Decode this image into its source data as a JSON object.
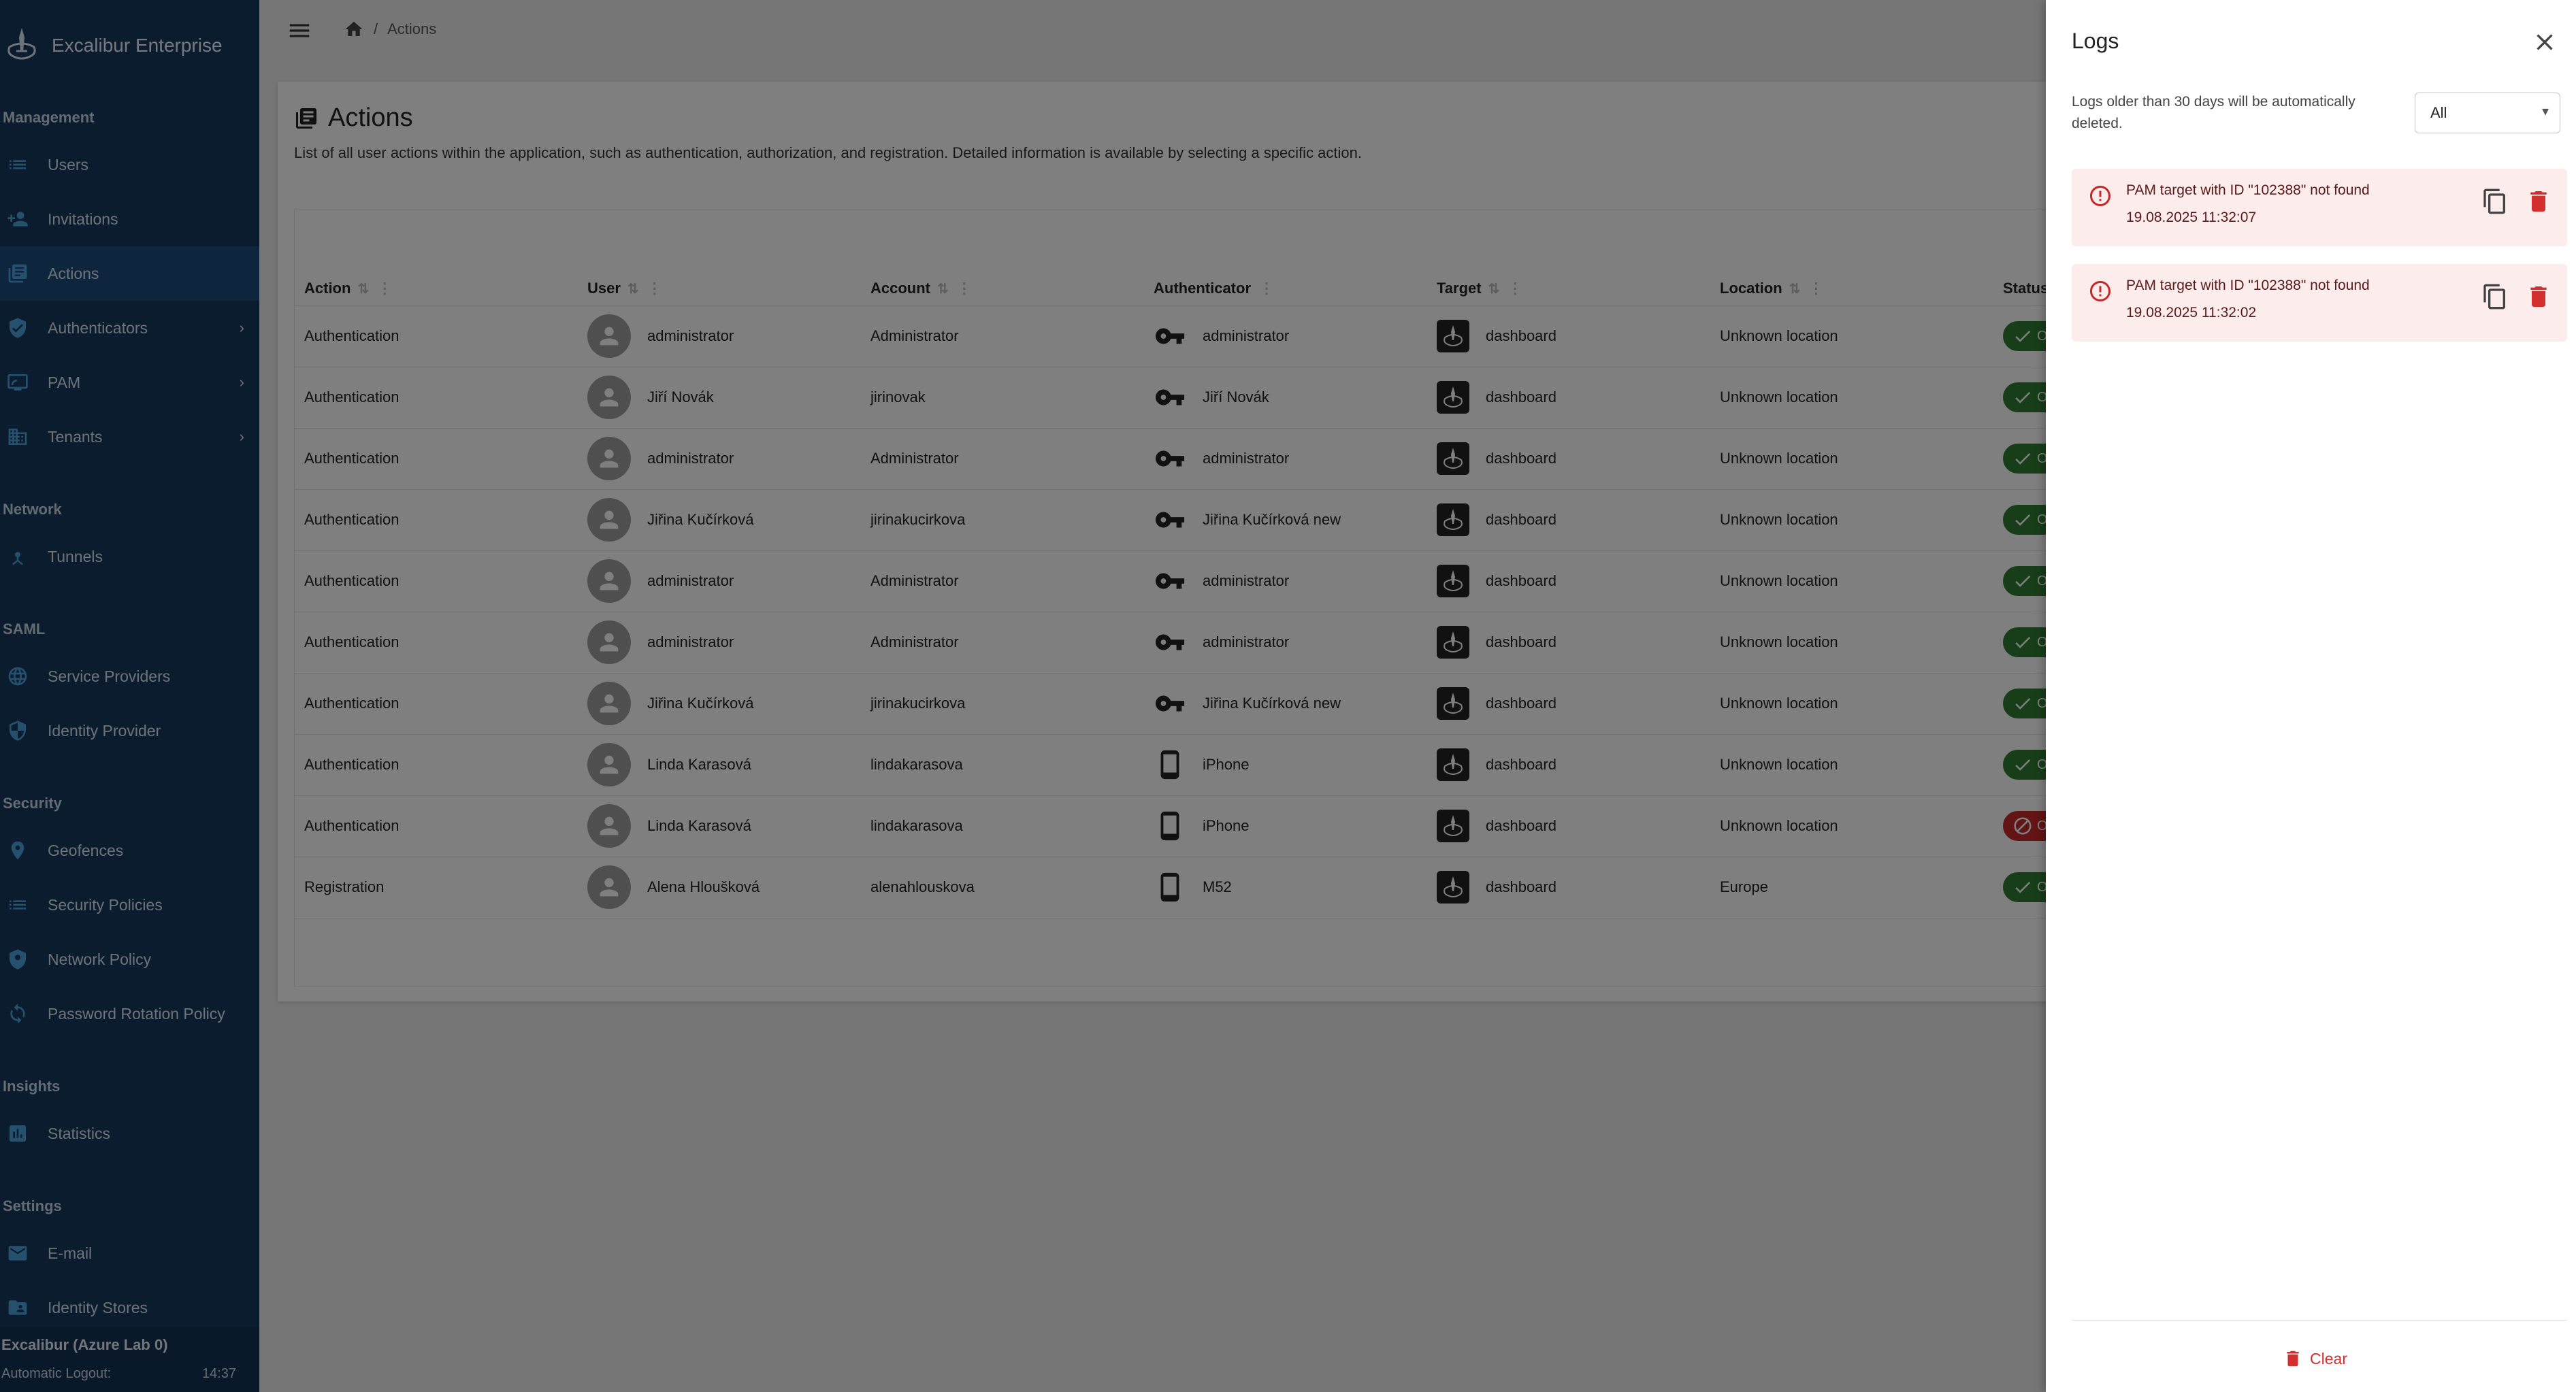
{
  "sidebar": {
    "brand": "Excalibur Enterprise",
    "sections": {
      "management": "Management",
      "network": "Network",
      "saml": "SAML",
      "security": "Security",
      "insights": "Insights",
      "settings": "Settings"
    },
    "items": {
      "users": "Users",
      "invitations": "Invitations",
      "actions": "Actions",
      "authenticators": "Authenticators",
      "pam": "PAM",
      "tenants": "Tenants",
      "tunnels": "Tunnels",
      "service_providers": "Service Providers",
      "identity_provider": "Identity Provider",
      "geofences": "Geofences",
      "security_policies": "Security Policies",
      "network_policy": "Network Policy",
      "password_rotation_policy": "Password Rotation Policy",
      "statistics": "Statistics",
      "email": "E-mail",
      "identity_stores": "Identity Stores"
    },
    "footer": {
      "org": "Excalibur (Azure Lab 0)",
      "logout_label": "Automatic Logout:",
      "timer": "14:37"
    }
  },
  "breadcrumb": {
    "sep": "/",
    "current": "Actions"
  },
  "page": {
    "title": "Actions",
    "description": "List of all user actions within the application, such as authentication, authorization, and registration. Detailed information is available by selecting a specific action."
  },
  "table": {
    "headers": {
      "action": "Action",
      "user": "User",
      "account": "Account",
      "authenticator": "Authenticator",
      "target": "Target",
      "location": "Location",
      "status": "Status"
    },
    "rows": [
      {
        "action": "Authentication",
        "user": "administrator",
        "account": "Administrator",
        "auth_type": "key",
        "authenticator": "administrator",
        "target": "dashboard",
        "location": "Unknown location",
        "status": "ok",
        "status_text": "O"
      },
      {
        "action": "Authentication",
        "user": "Jiří Novák",
        "account": "jirinovak",
        "auth_type": "key",
        "authenticator": "Jiří Novák",
        "target": "dashboard",
        "location": "Unknown location",
        "status": "ok",
        "status_text": "O"
      },
      {
        "action": "Authentication",
        "user": "administrator",
        "account": "Administrator",
        "auth_type": "key",
        "authenticator": "administrator",
        "target": "dashboard",
        "location": "Unknown location",
        "status": "ok",
        "status_text": "O"
      },
      {
        "action": "Authentication",
        "user": "Jiřina Kučírková",
        "account": "jirinakucirkova",
        "auth_type": "key",
        "authenticator": "Jiřina Kučírková new",
        "target": "dashboard",
        "location": "Unknown location",
        "status": "ok",
        "status_text": "O"
      },
      {
        "action": "Authentication",
        "user": "administrator",
        "account": "Administrator",
        "auth_type": "key",
        "authenticator": "administrator",
        "target": "dashboard",
        "location": "Unknown location",
        "status": "ok",
        "status_text": "O"
      },
      {
        "action": "Authentication",
        "user": "administrator",
        "account": "Administrator",
        "auth_type": "key",
        "authenticator": "administrator",
        "target": "dashboard",
        "location": "Unknown location",
        "status": "ok",
        "status_text": "O"
      },
      {
        "action": "Authentication",
        "user": "Jiřina Kučírková",
        "account": "jirinakucirkova",
        "auth_type": "key",
        "authenticator": "Jiřina Kučírková new",
        "target": "dashboard",
        "location": "Unknown location",
        "status": "ok",
        "status_text": "O"
      },
      {
        "action": "Authentication",
        "user": "Linda Karasová",
        "account": "lindakarasova",
        "auth_type": "phone",
        "authenticator": "iPhone",
        "target": "dashboard",
        "location": "Unknown location",
        "status": "ok",
        "status_text": "O"
      },
      {
        "action": "Authentication",
        "user": "Linda Karasová",
        "account": "lindakarasova",
        "auth_type": "phone",
        "authenticator": "iPhone",
        "target": "dashboard",
        "location": "Unknown location",
        "status": "fail",
        "status_text": "O"
      },
      {
        "action": "Registration",
        "user": "Alena Hloušková",
        "account": "alenahlouskova",
        "auth_type": "phone",
        "authenticator": "M52",
        "target": "dashboard",
        "location": "Europe",
        "status": "ok",
        "status_text": "O"
      }
    ]
  },
  "logs": {
    "title": "Logs",
    "retention_note": "Logs older than 30 days will be automatically deleted.",
    "filter_value": "All",
    "entries": [
      {
        "message": "PAM target with ID \"102388\" not found",
        "time": "19.08.2025 11:32:07"
      },
      {
        "message": "PAM target with ID \"102388\" not found",
        "time": "19.08.2025 11:32:02"
      }
    ],
    "clear_label": "Clear"
  },
  "colors": {
    "sidebar_bg": "#17385e",
    "sidebar_active": "#1d4a7c",
    "icon_accent": "#4aa3df",
    "success": "#2e7d32",
    "error": "#c62828",
    "log_bg": "#fdecec"
  }
}
